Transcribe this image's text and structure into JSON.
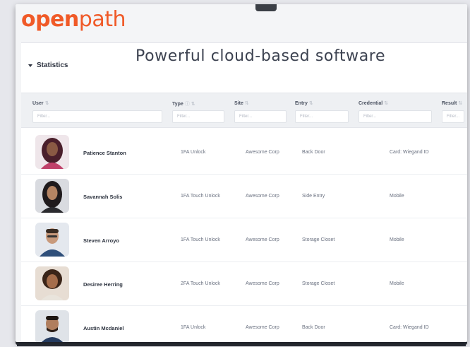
{
  "brand": {
    "logo_bold": "open",
    "logo_light": "path"
  },
  "tagline": "Powerful cloud-based software",
  "section": {
    "label": "Statistics"
  },
  "columns": [
    {
      "label": "User",
      "filter": "Filter..."
    },
    {
      "label": "Type",
      "filter": "Filter..."
    },
    {
      "label": "Site",
      "filter": "Filter..."
    },
    {
      "label": "Entry",
      "filter": "Filter..."
    },
    {
      "label": "Credential",
      "filter": "Filter..."
    },
    {
      "label": "Result",
      "filter": "Filter..."
    }
  ],
  "rows": [
    {
      "user": "Patience Stanton",
      "type": "1FA Unlock",
      "site": "Awesome Corp",
      "entry": "Back Door",
      "credential": "Card: Wiegand ID",
      "result": ""
    },
    {
      "user": "Savannah Solis",
      "type": "1FA Touch Unlock",
      "site": "Awesome Corp",
      "entry": "Side Entry",
      "credential": "Mobile",
      "result": ""
    },
    {
      "user": "Steven Arroyo",
      "type": "1FA Touch Unlock",
      "site": "Awesome Corp",
      "entry": "Storage Closet",
      "credential": "Mobile",
      "result": ""
    },
    {
      "user": "Desiree Herring",
      "type": "2FA Touch Unlock",
      "site": "Awesome Corp",
      "entry": "Storage Closet",
      "credential": "Mobile",
      "result": ""
    },
    {
      "user": "Austin Mcdaniel",
      "type": "1FA Unlock",
      "site": "Awesome Corp",
      "entry": "Back Door",
      "credential": "Card: Wiegand ID",
      "result": ""
    }
  ],
  "colors": {
    "brand": "#f05a28",
    "header_band": "#eef0f3"
  },
  "icons": {
    "section_toggle": "caret-down-icon",
    "sort": "sort-icon",
    "help": "help-circle-icon"
  }
}
